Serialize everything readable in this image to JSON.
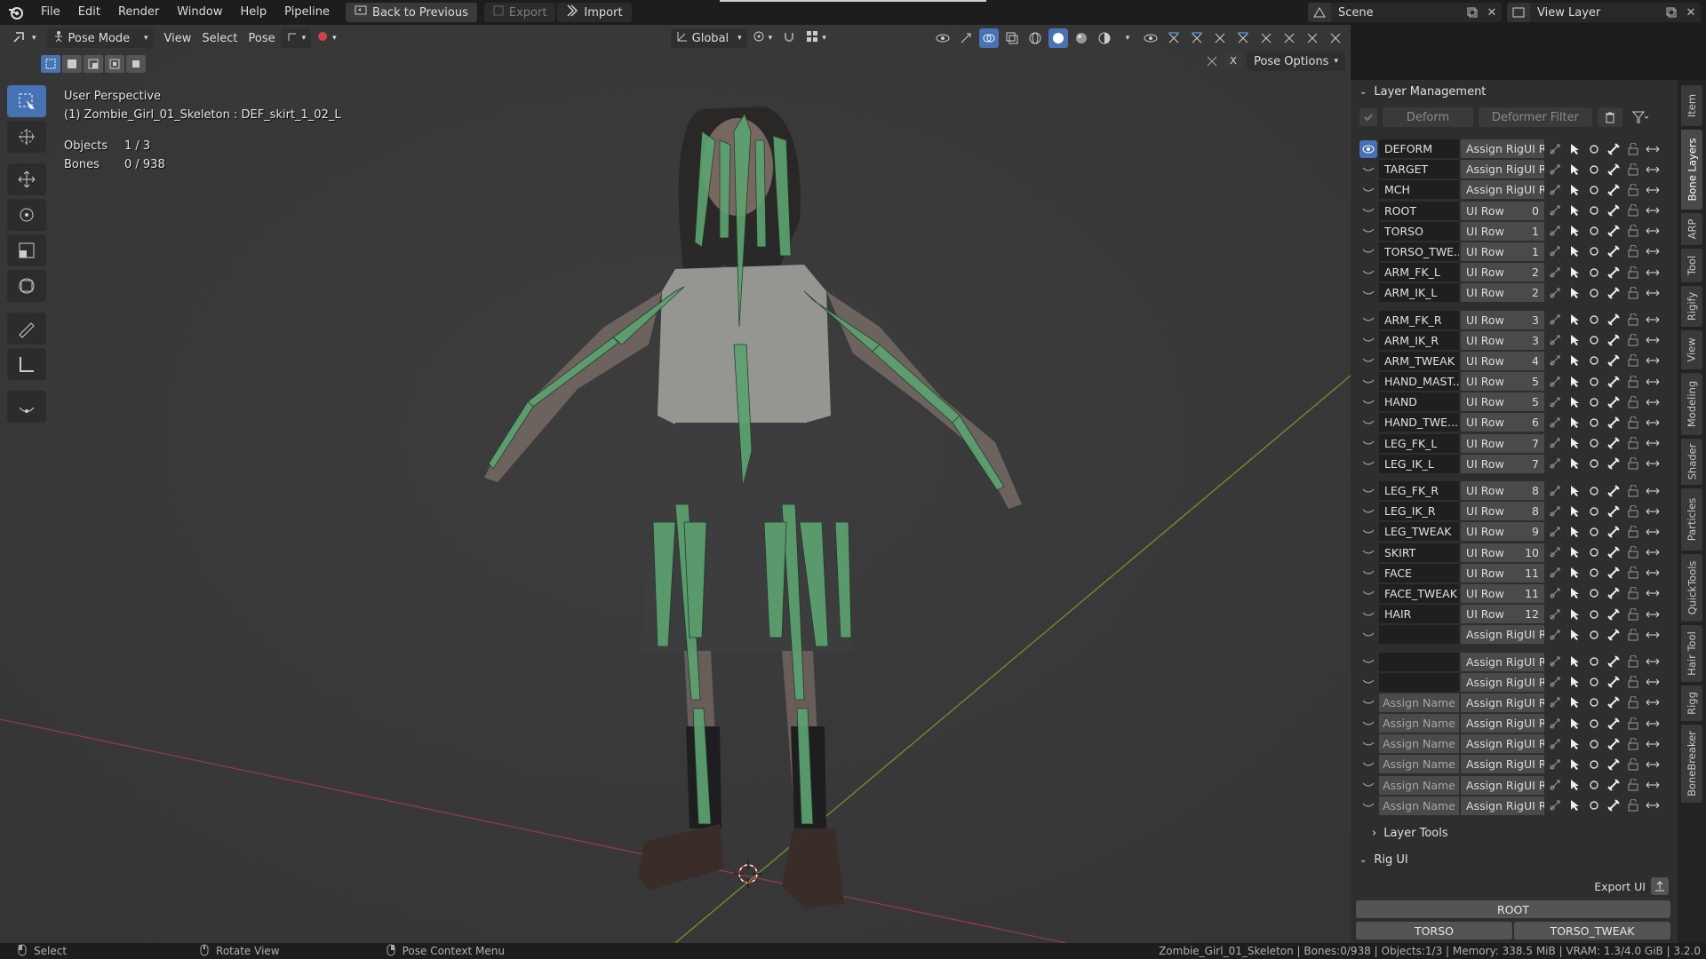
{
  "menubar": {
    "items": [
      "File",
      "Edit",
      "Render",
      "Window",
      "Help",
      "Pipeline"
    ],
    "back_to_previous": "Back to Previous",
    "export": "Export",
    "import": "Import",
    "scene": "Scene",
    "view_layer": "View Layer"
  },
  "viewport_header": {
    "mode": "Pose Mode",
    "menus": [
      "View",
      "Select",
      "Pose"
    ],
    "transform_orientation": "Global",
    "pose_options": "Pose Options"
  },
  "viewport_info": {
    "perspective": "User Perspective",
    "active": "(1) Zombie_Girl_01_Skeleton : DEF_skirt_1_02_L",
    "objects_label": "Objects",
    "objects_value": "1 / 3",
    "bones_label": "Bones",
    "bones_value": "0 / 938"
  },
  "layer_management": {
    "title": "Layer Management",
    "deform": "Deform",
    "deformer_filter": "Deformer Filter",
    "groups": [
      [
        {
          "name": "DEFORM",
          "ui": "Assign RigUI R...",
          "row": "",
          "eye": true
        },
        {
          "name": "TARGET",
          "ui": "Assign RigUI R...",
          "row": ""
        },
        {
          "name": "MCH",
          "ui": "Assign RigUI R...",
          "row": ""
        },
        {
          "name": "ROOT",
          "ui": "UI Row",
          "row": "0"
        },
        {
          "name": "TORSO",
          "ui": "UI Row",
          "row": "1"
        },
        {
          "name": "TORSO_TWE...",
          "ui": "UI Row",
          "row": "1"
        },
        {
          "name": "ARM_FK_L",
          "ui": "UI Row",
          "row": "2"
        },
        {
          "name": "ARM_IK_L",
          "ui": "UI Row",
          "row": "2"
        }
      ],
      [
        {
          "name": "ARM_FK_R",
          "ui": "UI Row",
          "row": "3"
        },
        {
          "name": "ARM_IK_R",
          "ui": "UI Row",
          "row": "3"
        },
        {
          "name": "ARM_TWEAK",
          "ui": "UI Row",
          "row": "4"
        },
        {
          "name": "HAND_MAST...",
          "ui": "UI Row",
          "row": "5"
        },
        {
          "name": "HAND",
          "ui": "UI Row",
          "row": "5"
        },
        {
          "name": "HAND_TWE...",
          "ui": "UI Row",
          "row": "6"
        },
        {
          "name": "LEG_FK_L",
          "ui": "UI Row",
          "row": "7"
        },
        {
          "name": "LEG_IK_L",
          "ui": "UI Row",
          "row": "7"
        }
      ],
      [
        {
          "name": "LEG_FK_R",
          "ui": "UI Row",
          "row": "8"
        },
        {
          "name": "LEG_IK_R",
          "ui": "UI Row",
          "row": "8"
        },
        {
          "name": "LEG_TWEAK",
          "ui": "UI Row",
          "row": "9"
        },
        {
          "name": "SKIRT",
          "ui": "UI Row",
          "row": "10"
        },
        {
          "name": "FACE",
          "ui": "UI Row",
          "row": "11"
        },
        {
          "name": "FACE_TWEAK",
          "ui": "UI Row",
          "row": "11"
        },
        {
          "name": "HAIR",
          "ui": "UI Row",
          "row": "12"
        },
        {
          "name": "",
          "ui": "Assign RigUI R...",
          "row": ""
        }
      ],
      [
        {
          "name": "",
          "ui": "Assign RigUI R...",
          "row": ""
        },
        {
          "name": "",
          "ui": "Assign RigUI R...",
          "row": ""
        },
        {
          "name": "Assign Name",
          "ui": "Assign RigUI R...",
          "row": "",
          "placeholder": true
        },
        {
          "name": "Assign Name",
          "ui": "Assign RigUI R...",
          "row": "",
          "placeholder": true
        },
        {
          "name": "Assign Name",
          "ui": "Assign RigUI R...",
          "row": "",
          "placeholder": true
        },
        {
          "name": "Assign Name",
          "ui": "Assign RigUI R...",
          "row": "",
          "placeholder": true
        },
        {
          "name": "Assign Name",
          "ui": "Assign RigUI R...",
          "row": "",
          "placeholder": true
        },
        {
          "name": "Assign Name",
          "ui": "Assign RigUI R...",
          "row": "",
          "placeholder": true
        }
      ]
    ]
  },
  "layer_tools": "Layer Tools",
  "rig_ui": {
    "title": "Rig UI",
    "export_ui": "Export UI",
    "root": "ROOT",
    "torso": "TORSO",
    "torso_tweak": "TORSO_TWEAK"
  },
  "vtabs": [
    "Item",
    "Bone Layers",
    "ARP",
    "Tool",
    "Rigify",
    "View",
    "Modeling",
    "Shader",
    "Particles",
    "QuickTools",
    "Hair Tool",
    "Rigg",
    "BoneBreaker"
  ],
  "statusbar": {
    "select": "Select",
    "rotate_view": "Rotate View",
    "pose_context_menu": "Pose Context Menu",
    "info": "Zombie_Girl_01_Skeleton | Bones:0/938 | Objects:1/3 | Memory: 338.5 MiB | VRAM: 1.3/4.0 GiB | 3.2.0"
  },
  "colors": {
    "accent": "#4772b3",
    "bone": "#5fa874",
    "x_axis": "#9c3a47",
    "y_axis": "#6b8f2f"
  }
}
